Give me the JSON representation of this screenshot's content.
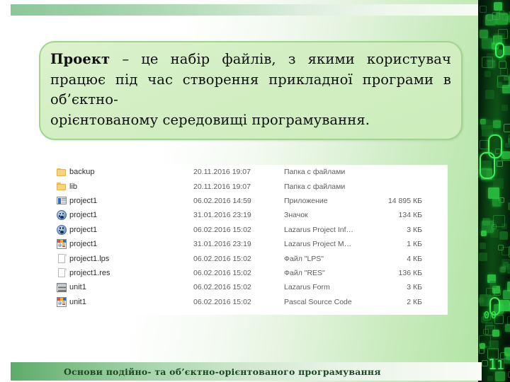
{
  "slide": {
    "accent_color": "#9fd58c",
    "callout_fill": "#d2eec2",
    "footer_accent": "#5eab6b",
    "matrix_strip_color": "#04230c",
    "matrix_glyph_color": "#3cf05a"
  },
  "callout": {
    "term": "Проект",
    "definition": " – це набір файлів, з якими користувач працює під час створення прикладної програми в об’єктно-",
    "last_line": "орієнтованому середовищі програмування."
  },
  "explorer": {
    "rows": [
      {
        "icon": "folder-icon",
        "name": "backup",
        "date": "20.11.2016 19:07",
        "type": "Папка с файлами",
        "size": ""
      },
      {
        "icon": "folder-icon",
        "name": "lib",
        "date": "20.11.2016 19:07",
        "type": "Папка с файлами",
        "size": ""
      },
      {
        "icon": "application-icon",
        "name": "project1",
        "date": "06.02.2016 14:59",
        "type": "Приложение",
        "size": "14 895 КБ"
      },
      {
        "icon": "badge-icon",
        "name": "project1",
        "date": "31.01.2016 23:19",
        "type": "Значок",
        "size": "134 КБ"
      },
      {
        "icon": "badge-icon",
        "name": "project1",
        "date": "06.02.2016 15:02",
        "type": "Lazarus Project Inf…",
        "size": "3 КБ"
      },
      {
        "icon": "lazarus-icon",
        "name": "project1",
        "date": "31.01.2016 23:19",
        "type": "Lazarus Project M…",
        "size": "1 КБ"
      },
      {
        "icon": "document-icon",
        "name": "project1.lps",
        "date": "06.02.2016 15:02",
        "type": "Файл \"LPS\"",
        "size": "4 КБ"
      },
      {
        "icon": "document-icon",
        "name": "project1.res",
        "date": "06.02.2016 15:02",
        "type": "Файл \"RES\"",
        "size": "136 КБ"
      },
      {
        "icon": "lazarus-form-icon",
        "name": "unit1",
        "date": "06.02.2016 15:02",
        "type": "Lazarus Form",
        "size": "3 КБ"
      },
      {
        "icon": "lazarus-icon",
        "name": "unit1",
        "date": "06.02.2016 15:02",
        "type": "Pascal Source Code",
        "size": "2 КБ"
      }
    ]
  },
  "footer": {
    "text": "Основи подійно- та об’єктно-орієнтованого програмування"
  }
}
